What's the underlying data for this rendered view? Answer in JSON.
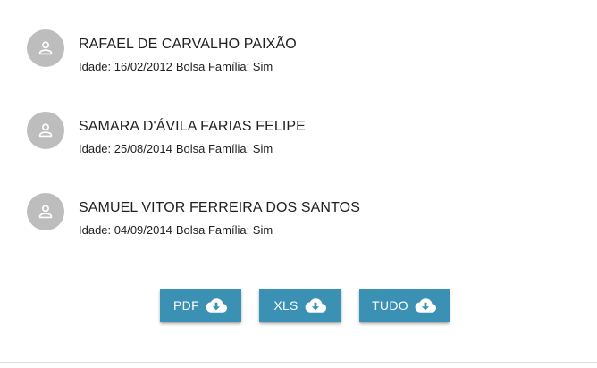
{
  "students": [
    {
      "name": "RAFAEL DE CARVALHO PAIXÃO",
      "age_label": "Idade: 16/02/2012",
      "bolsa_label": "Bolsa Família: Sim",
      "avatar_icon": "person-icon"
    },
    {
      "name": "SAMARA D'ÁVILA FARIAS FELIPE",
      "age_label": "Idade: 25/08/2014",
      "bolsa_label": "Bolsa Família: Sim",
      "avatar_icon": "person-icon"
    },
    {
      "name": "SAMUEL VITOR FERREIRA DOS SANTOS",
      "age_label": "Idade: 04/09/2014",
      "bolsa_label": "Bolsa Família: Sim",
      "avatar_icon": "person-icon"
    }
  ],
  "actions": {
    "pdf_label": "PDF",
    "xls_label": "XLS",
    "all_label": "TUDO",
    "icon": "cloud-download-icon"
  },
  "colors": {
    "button_bg": "#3a91b4",
    "avatar_bg": "#bdbdbd",
    "text": "#212121"
  }
}
